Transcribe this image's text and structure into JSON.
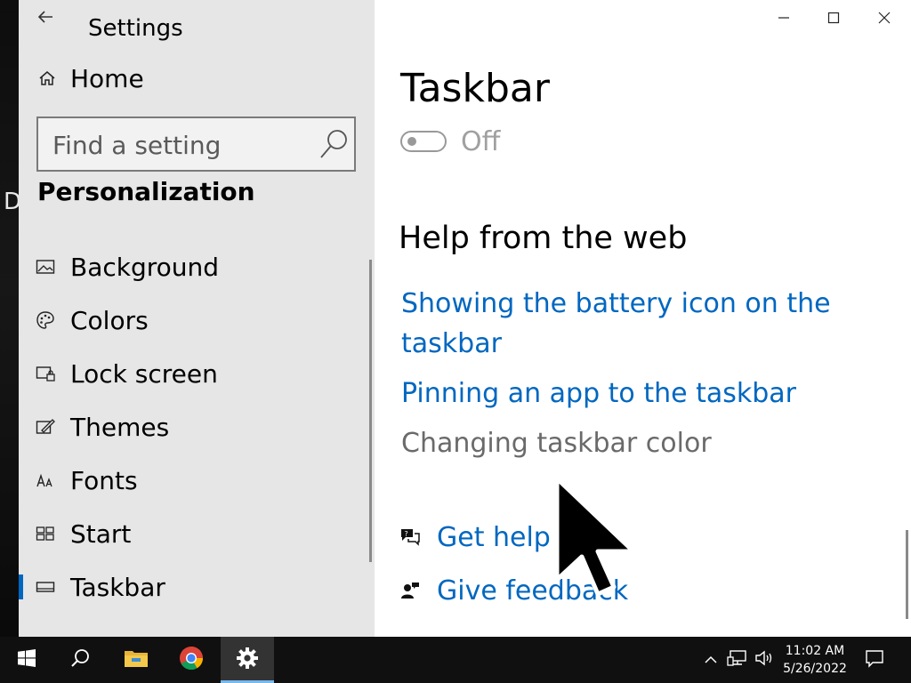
{
  "window": {
    "app_title": "Settings",
    "controls": [
      "minimize",
      "maximize",
      "close"
    ]
  },
  "sidebar": {
    "home_label": "Home",
    "search": {
      "placeholder": "Find a setting",
      "value": ""
    },
    "section_title": "Personalization",
    "items": [
      {
        "label": "Background",
        "icon": "picture-icon",
        "selected": false
      },
      {
        "label": "Colors",
        "icon": "palette-icon",
        "selected": false
      },
      {
        "label": "Lock screen",
        "icon": "lock-screen-icon",
        "selected": false
      },
      {
        "label": "Themes",
        "icon": "themes-brush-icon",
        "selected": false
      },
      {
        "label": "Fonts",
        "icon": "fonts-icon",
        "selected": false
      },
      {
        "label": "Start",
        "icon": "start-tiles-icon",
        "selected": false
      },
      {
        "label": "Taskbar",
        "icon": "taskbar-icon",
        "selected": true
      }
    ]
  },
  "main": {
    "page_title": "Taskbar",
    "toggle": {
      "state_label": "Off",
      "on": false
    },
    "help_title": "Help from the web",
    "links": [
      {
        "line1": "Showing the battery icon on the",
        "line2": "taskbar"
      },
      {
        "line1": "Pinning an app to the taskbar"
      },
      {
        "line1": "Changing taskbar color"
      }
    ],
    "footer": {
      "get_help": "Get help",
      "give_feedback": "Give feedback"
    }
  },
  "desktop": {
    "partial_letter": "D"
  },
  "taskbar": {
    "clock_time": "11:02 AM",
    "clock_date": "5/26/2022"
  },
  "colors": {
    "accent": "#0067c0",
    "sidebar_bg": "#e6e6e6",
    "taskbar_bg": "#101010"
  }
}
